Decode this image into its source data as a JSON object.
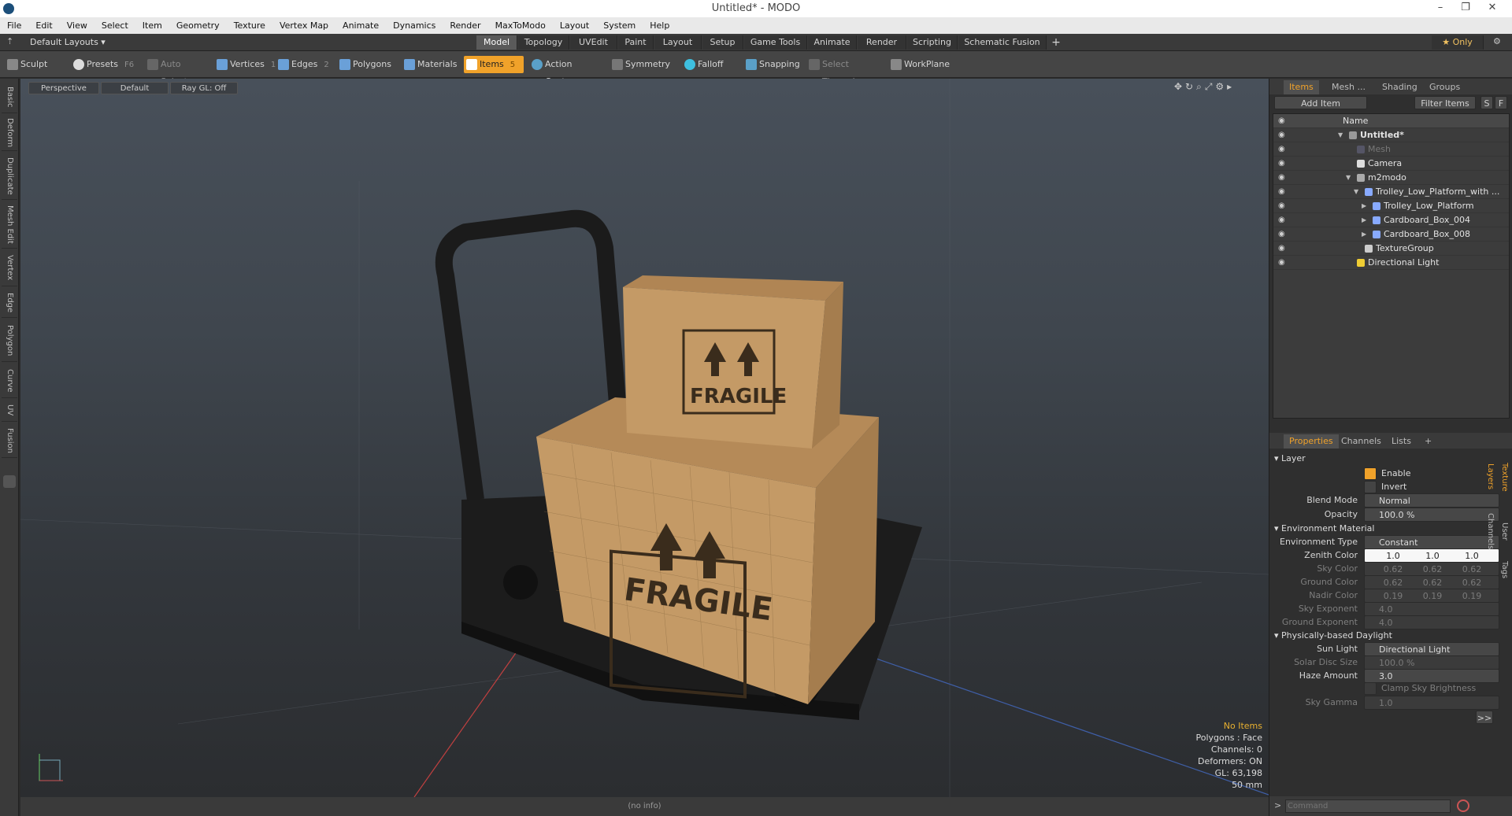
{
  "window": {
    "title": "Untitled* - MODO",
    "min": "–",
    "restore": "❐",
    "close": "✕"
  },
  "menu": [
    "File",
    "Edit",
    "View",
    "Select",
    "Item",
    "Geometry",
    "Texture",
    "Vertex Map",
    "Animate",
    "Dynamics",
    "Render",
    "MaxToModo",
    "Layout",
    "System",
    "Help"
  ],
  "layouts": {
    "label": "Default Layouts ▾",
    "tabs": [
      "Model",
      "Topology",
      "UVEdit",
      "Paint",
      "Layout",
      "Setup",
      "Game Tools",
      "Animate",
      "Render",
      "Scripting",
      "Schematic Fusion"
    ],
    "add": "+",
    "only": "★ Only"
  },
  "toolbar": {
    "sculpt": "Sculpt",
    "presets": "Presets",
    "presets_key": "F6",
    "auto_select": "Auto Select",
    "vertices": "Vertices",
    "vertices_key": "1",
    "edges": "Edges",
    "edges_key": "2",
    "polygons": "Polygons",
    "materials": "Materials",
    "items": "Items",
    "items_key": "5",
    "action_center": "Action Center",
    "symmetry": "Symmetry",
    "falloff": "Falloff",
    "snapping": "Snapping",
    "select_through": "Select Through",
    "workplane": "WorkPlane"
  },
  "left_tabs": [
    "Basic",
    "Deform",
    "Duplicate",
    "Mesh Edit",
    "Vertex",
    "Edge",
    "Polygon",
    "Curve",
    "UV",
    "Fusion"
  ],
  "viewport": {
    "view": "Perspective",
    "shading": "Default",
    "raygl": "Ray GL: Off",
    "info": {
      "items": "No Items",
      "polygons": "Polygons : Face",
      "channels": "Channels: 0",
      "deformers": "Deformers: ON",
      "gl": "GL: 63,198",
      "focal": "50 mm"
    },
    "box_label": "FRAGILE",
    "status": "(no info)"
  },
  "items_panel": {
    "tabs": [
      "Items",
      "Mesh ...",
      "Shading",
      "Groups"
    ],
    "add_item": "Add Item",
    "filter_items": "Filter Items",
    "s": "S",
    "f": "F",
    "column_name": "Name",
    "rows": [
      "Untitled*",
      "Mesh",
      "Camera",
      "m2modo",
      "Trolley_Low_Platform_with ...",
      "Trolley_Low_Platform",
      "Cardboard_Box_004",
      "Cardboard_Box_008",
      "TextureGroup",
      "Directional Light"
    ]
  },
  "properties": {
    "tabs": [
      "Properties",
      "Channels",
      "Lists"
    ],
    "add": "+",
    "layer": "Layer",
    "enable": "Enable",
    "invert": "Invert",
    "blend_mode_label": "Blend Mode",
    "blend_mode": "Normal",
    "opacity_label": "Opacity",
    "opacity": "100.0 %",
    "env_material": "Environment Material",
    "env_type_label": "Environment Type",
    "env_type": "Constant",
    "zenith_label": "Zenith Color",
    "zenith": [
      "1.0",
      "1.0",
      "1.0"
    ],
    "sky_label": "Sky Color",
    "sky": [
      "0.62",
      "0.62",
      "0.62"
    ],
    "ground_label": "Ground Color",
    "ground": [
      "0.62",
      "0.62",
      "0.62"
    ],
    "nadir_label": "Nadir Color",
    "nadir": [
      "0.19",
      "0.19",
      "0.19"
    ],
    "sky_exp_label": "Sky Exponent",
    "sky_exp": "4.0",
    "ground_exp_label": "Ground Exponent",
    "ground_exp": "4.0",
    "daylight": "Physically-based Daylight",
    "sun_label": "Sun Light",
    "sun": "Directional Light",
    "solar_label": "Solar Disc Size",
    "solar": "100.0 %",
    "haze_label": "Haze Amount",
    "haze": "3.0",
    "clamp": "Clamp Sky Brightness",
    "gamma_label": "Sky Gamma",
    "gamma": "1.0",
    "more": ">>",
    "side_tabs": [
      "Texture Layers",
      "User Channels",
      "Tags"
    ]
  },
  "command": {
    "prompt": ">",
    "placeholder": "Command"
  },
  "colors": {
    "accent": "#f0a22a",
    "cardboard": "#c49a66",
    "trolley": "#1e1e1e"
  }
}
